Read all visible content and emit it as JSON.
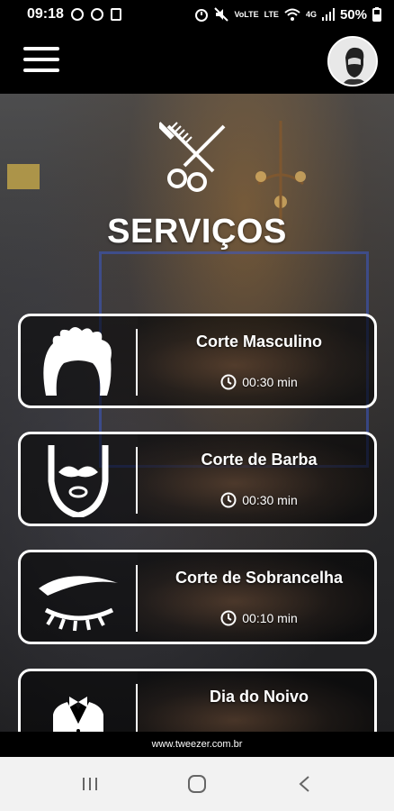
{
  "status_bar": {
    "time": "09:18",
    "volte_top": "VoLTE",
    "lte": "LTE",
    "network": "4G",
    "battery": "50%"
  },
  "app_bar": {
    "menu_icon": "hamburger-menu-icon",
    "avatar_icon": "bearded-man-avatar"
  },
  "page": {
    "title": "SERVIÇOS",
    "header_icon": "comb-scissors-icon"
  },
  "services": [
    {
      "name": "Corte Masculino",
      "duration": "00:30 min",
      "icon": "hair-icon"
    },
    {
      "name": "Corte de Barba",
      "duration": "00:30 min",
      "icon": "beard-icon"
    },
    {
      "name": "Corte de Sobrancelha",
      "duration": "00:10 min",
      "icon": "eyebrow-icon"
    },
    {
      "name": "Dia do Noivo",
      "duration": "",
      "icon": "tuxedo-icon"
    }
  ],
  "footer": {
    "website": "www.tweezer.com.br"
  },
  "nav": {
    "recents_icon": "recents-icon",
    "home_icon": "home-icon",
    "back_icon": "back-icon"
  }
}
